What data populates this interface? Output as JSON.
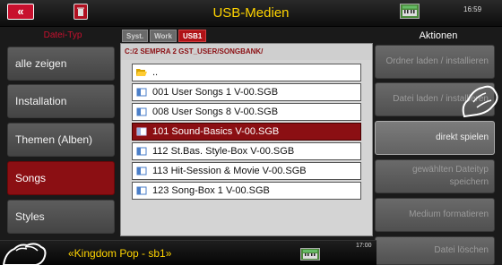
{
  "header": {
    "back_icon": "«",
    "title": "USB-Medien",
    "clock": "16:59"
  },
  "left_panel": {
    "header": "Datei-Typ",
    "items": [
      {
        "label": "alle zeigen",
        "active": false
      },
      {
        "label": "Installation",
        "active": false
      },
      {
        "label": "Themen (Alben)",
        "active": false
      },
      {
        "label": "Songs",
        "active": true
      },
      {
        "label": "Styles",
        "active": false
      }
    ]
  },
  "center": {
    "tabs": [
      {
        "label": "Syst.",
        "active": false
      },
      {
        "label": "Work",
        "active": false
      },
      {
        "label": "USB1",
        "active": true
      }
    ],
    "path": "C:/2 SEMPRA 2 GST_USER/SONGBANK/",
    "parent_dir_label": "..",
    "files": [
      {
        "name": "001 User Songs 1 V-00.SGB",
        "selected": false
      },
      {
        "name": "008 User Songs 8 V-00.SGB",
        "selected": false
      },
      {
        "name": "101 Sound-Basics V-00.SGB",
        "selected": true
      },
      {
        "name": "112 St.Bas. Style-Box V-00.SGB",
        "selected": false
      },
      {
        "name": "113 Hit-Session & Movie V-00.SGB",
        "selected": false
      },
      {
        "name": "123 Song-Box 1 V-00.SGB",
        "selected": false
      }
    ]
  },
  "right_panel": {
    "header": "Aktionen",
    "actions": [
      {
        "label": "Ordner laden / installieren",
        "enabled": false
      },
      {
        "label": "Datei laden / installieren",
        "enabled": false
      },
      {
        "label": "direkt spielen",
        "enabled": true
      },
      {
        "label": "gewählten Dateityp speichern",
        "enabled": false
      },
      {
        "label": "Medium formatieren",
        "enabled": false
      },
      {
        "label": "Datei löschen",
        "enabled": false
      }
    ]
  },
  "bottom_bar": {
    "song_title": "«Kingdom Pop - sb1»",
    "clock": "17:00"
  },
  "colors": {
    "accent_red": "#8b0f13",
    "title_yellow": "#ffd400"
  }
}
